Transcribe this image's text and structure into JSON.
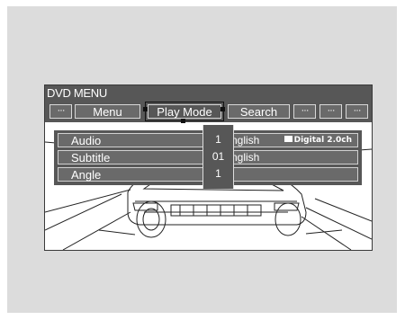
{
  "menu": {
    "title": "DVD MENU",
    "dots": "···",
    "buttons": {
      "menu": "Menu",
      "play_mode": "Play Mode",
      "search": "Search"
    }
  },
  "settings": [
    {
      "label": "Audio",
      "number": "1",
      "value": "English",
      "extra": "Digital 2.0ch"
    },
    {
      "label": "Subtitle",
      "number": "01",
      "value": "English",
      "extra": ""
    },
    {
      "label": "Angle",
      "number": "1",
      "value": "",
      "extra": ""
    }
  ],
  "icons": {
    "dolby_logo": "dolby-double-d-icon",
    "selection_frame": "selection-corner-icon"
  },
  "colors": {
    "bar": "#575757",
    "button": "#6a6a6a",
    "frame": "#111111",
    "background": "#dcdcdc"
  }
}
